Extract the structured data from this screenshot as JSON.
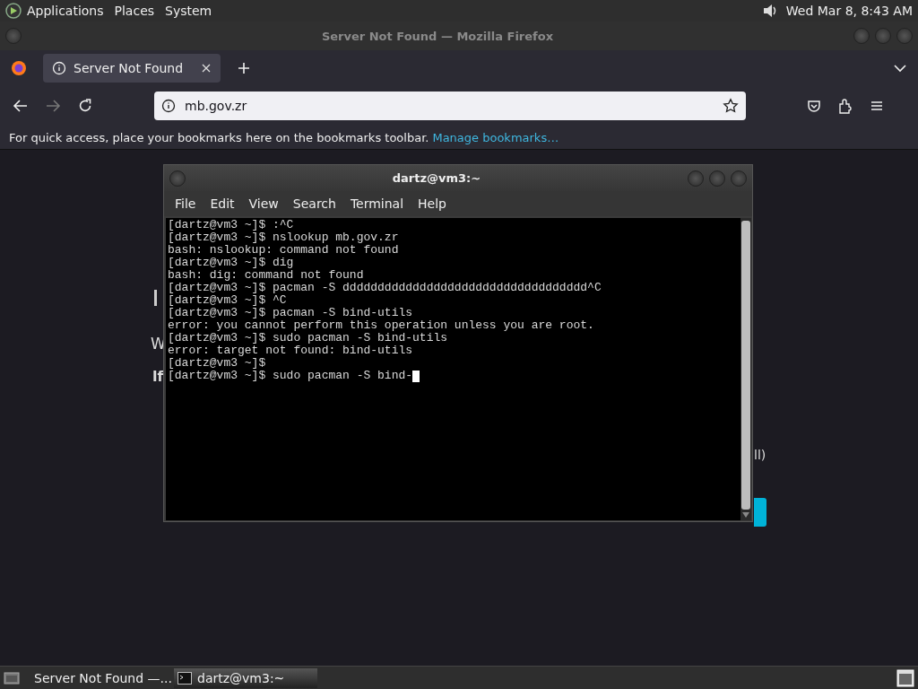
{
  "top_panel": {
    "menus": [
      "Applications",
      "Places",
      "System"
    ],
    "clock": "Wed Mar 8,  8:43 AM"
  },
  "browser": {
    "title": "Server Not Found — Mozilla Firefox",
    "tabs": [
      {
        "label": "Server Not Found",
        "selected": true
      }
    ],
    "url": "mb.gov.zr",
    "bookmarks_hint": "For quick access, place your bookmarks here on the bookmarks toolbar.",
    "bookmarks_link": "Manage bookmarks…",
    "page_fragments": [
      "W",
      "If",
      "ll)"
    ]
  },
  "terminal": {
    "title": "dartz@vm3:~",
    "menus": [
      "File",
      "Edit",
      "View",
      "Search",
      "Terminal",
      "Help"
    ],
    "lines": [
      "[dartz@vm3 ~]$ :^C",
      "[dartz@vm3 ~]$ nslookup mb.gov.zr",
      "bash: nslookup: command not found",
      "[dartz@vm3 ~]$ dig",
      "bash: dig: command not found",
      "[dartz@vm3 ~]$ pacman -S ddddddddddddddddddddddddddddddddddd^C",
      "[dartz@vm3 ~]$ ^C",
      "[dartz@vm3 ~]$ pacman -S bind-utils",
      "error: you cannot perform this operation unless you are root.",
      "[dartz@vm3 ~]$ sudo pacman -S bind-utils",
      "error: target not found: bind-utils",
      "[dartz@vm3 ~]$",
      "[dartz@vm3 ~]$ sudo pacman -S bind-"
    ]
  },
  "taskbar": {
    "tasks": [
      {
        "label": "Server Not Found —...",
        "kind": "browser",
        "selected": false
      },
      {
        "label": "dartz@vm3:~",
        "kind": "terminal",
        "selected": true
      }
    ]
  }
}
